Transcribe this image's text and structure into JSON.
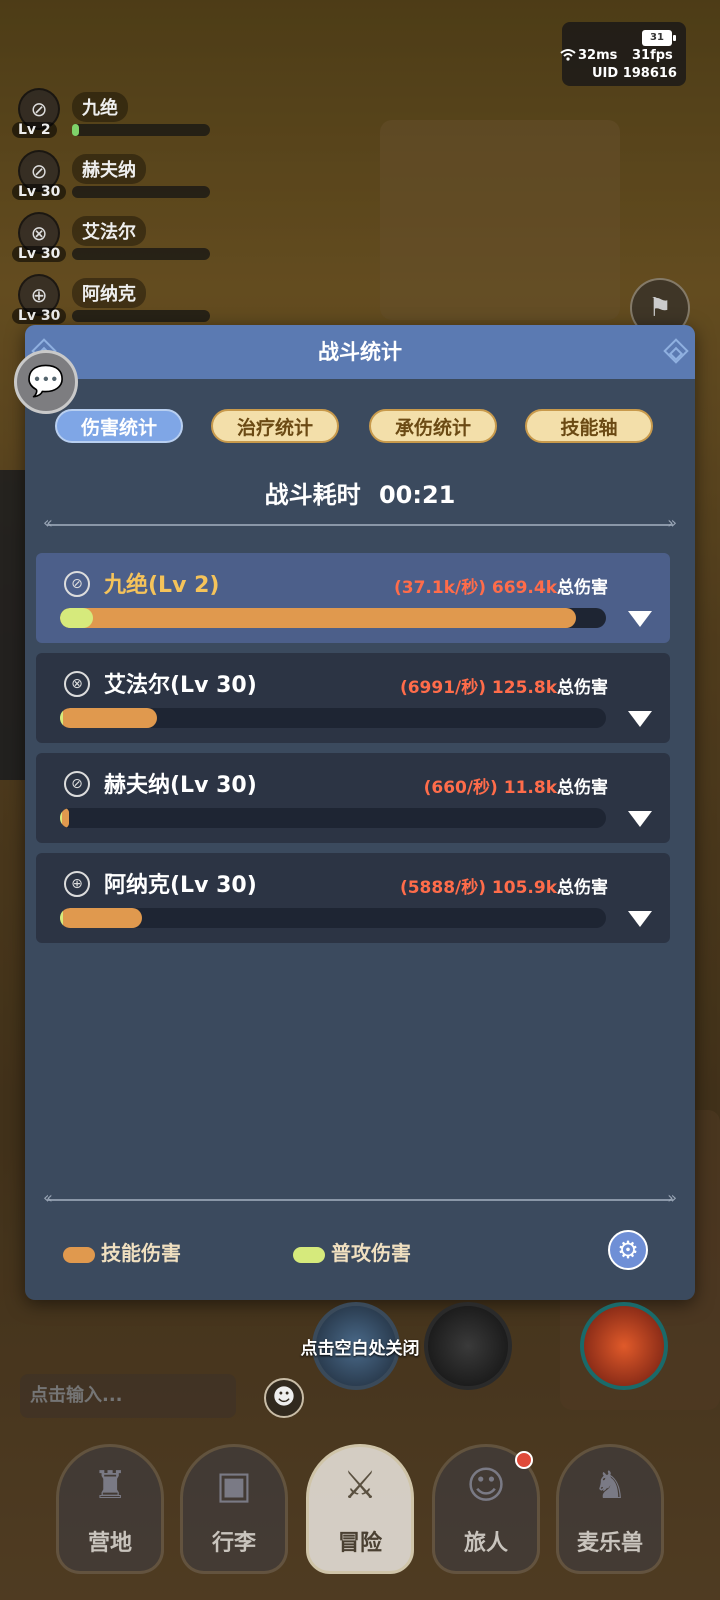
{
  "status": {
    "ping": "32ms",
    "fps": "31fps",
    "uid": "UID 198616",
    "battery_level": "31"
  },
  "party": [
    {
      "name": "九绝",
      "level": "Lv 2",
      "hp_fraction": 0.05
    },
    {
      "name": "赫夫纳",
      "level": "Lv 30",
      "hp_fraction": 0
    },
    {
      "name": "艾法尔",
      "level": "Lv 30",
      "hp_fraction": 0
    },
    {
      "name": "阿纳克",
      "level": "Lv 30",
      "hp_fraction": 0
    }
  ],
  "modal": {
    "title": "战斗统计",
    "tabs": [
      "伤害统计",
      "治疗统计",
      "承伤统计",
      "技能轴"
    ],
    "active_tab": "伤害统计",
    "elapsed_label": "战斗耗时",
    "elapsed_time": "00:21",
    "rows": [
      {
        "name": "九绝(Lv 2)",
        "rate": "(37.1k/秒)",
        "total": "669.4k",
        "total_label": "总伤害",
        "skill_fraction": 0.945,
        "normal_fraction": 0.06
      },
      {
        "name": "艾法尔(Lv 30)",
        "rate": "(6991/秒)",
        "total": "125.8k",
        "total_label": "总伤害",
        "skill_fraction": 0.178,
        "normal_fraction": 0.005
      },
      {
        "name": "赫夫纳(Lv 30)",
        "rate": "(660/秒)",
        "total": "11.8k",
        "total_label": "总伤害",
        "skill_fraction": 0.017,
        "normal_fraction": 0.003
      },
      {
        "name": "阿纳克(Lv 30)",
        "rate": "(5888/秒)",
        "total": "105.9k",
        "total_label": "总伤害",
        "skill_fraction": 0.15,
        "normal_fraction": 0.005
      }
    ],
    "legend": {
      "skill": "技能伤害",
      "normal": "普攻伤害"
    }
  },
  "colors": {
    "skill": "#e0994e",
    "normal": "#d6ea7c",
    "header": "#5b7ab2",
    "damage_text": "#ff6c4a",
    "selected_name": "#f5c35a"
  },
  "close_tip": "点击空白处关闭",
  "chat": {
    "placeholder": "点击输入..."
  },
  "nav": [
    "营地",
    "行李",
    "冒险",
    "旅人",
    "麦乐兽"
  ],
  "nav_active": "冒险",
  "icons": [
    "wifi-icon",
    "battery-icon",
    "chat-bubble-icon",
    "gear-icon",
    "emoji-icon",
    "chevron-down-icon"
  ]
}
